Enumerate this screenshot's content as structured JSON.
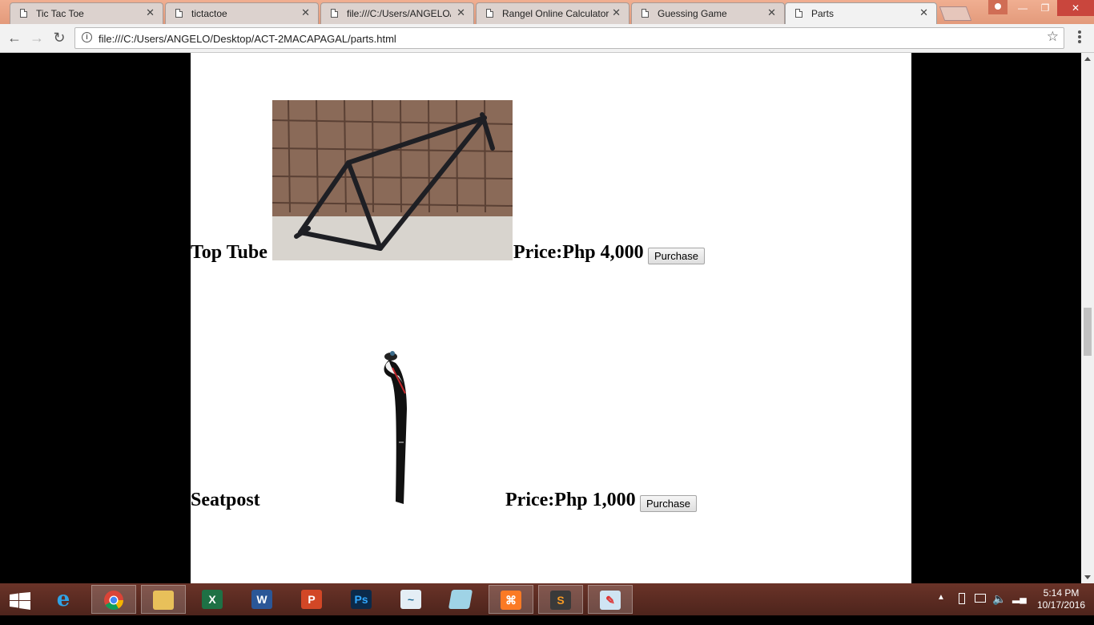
{
  "browser": {
    "tabs": [
      {
        "label": "Tic Tac Toe",
        "active": false
      },
      {
        "label": "tictactoe",
        "active": false
      },
      {
        "label": "file:///C:/Users/ANGELO/",
        "active": false
      },
      {
        "label": "Rangel Online Calculator",
        "active": false
      },
      {
        "label": "Guessing Game",
        "active": false
      },
      {
        "label": "Parts",
        "active": true
      }
    ],
    "address": "file:///C:/Users/ANGELO/Desktop/ACT-2MACAPAGAL/parts.html"
  },
  "page": {
    "products": [
      {
        "name": "Top Tube",
        "price": "Price:Php 4,000",
        "button": "Purchase",
        "image_icon": "bike-frame-image"
      },
      {
        "name": "Seatpost",
        "price": "Price:Php 1,000",
        "button": "Purchase",
        "image_icon": "seatpost-image"
      }
    ]
  },
  "taskbar": {
    "time": "5:14 PM",
    "date": "10/17/2016",
    "apps": [
      "start",
      "internet-explorer",
      "chrome",
      "file-explorer",
      "excel",
      "word",
      "powerpoint",
      "photoshop",
      "mysql-installer",
      "notepad",
      "xampp",
      "sublime-text",
      "paint"
    ],
    "accent": "#5b2b22"
  }
}
